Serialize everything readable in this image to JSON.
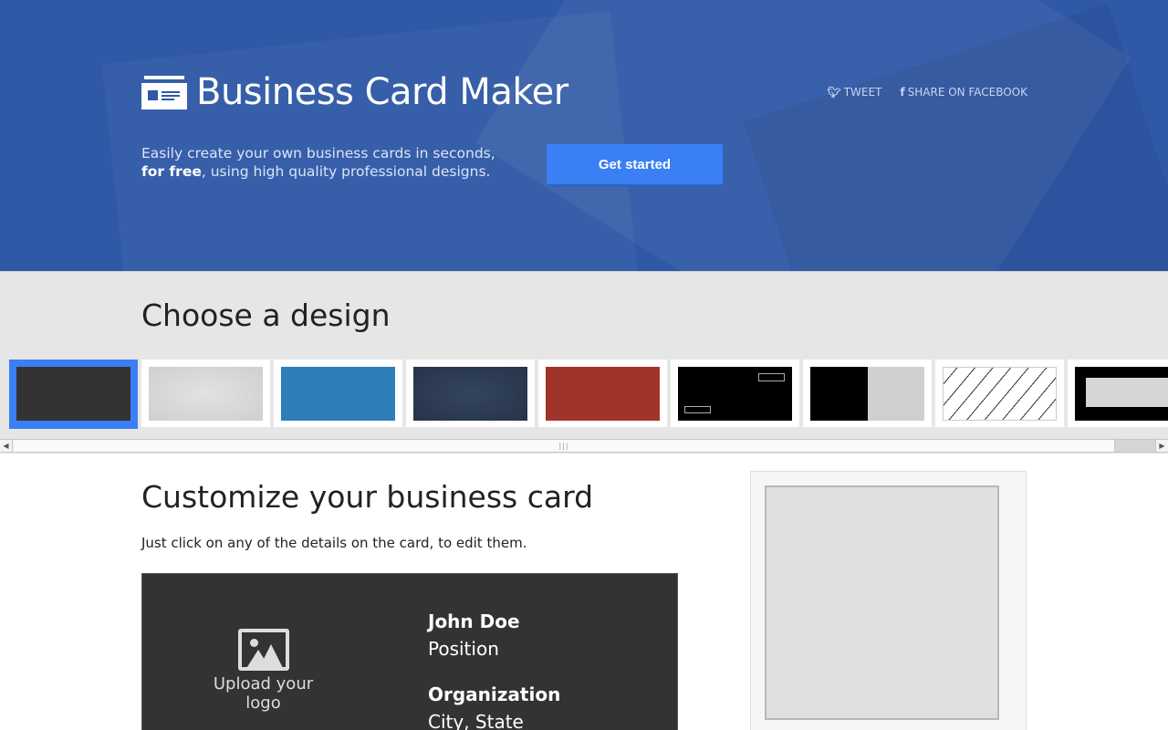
{
  "header": {
    "title": "Business Card Maker",
    "share": {
      "tweet_icon": "twitter-bird-icon",
      "tweet_label": "TWEET",
      "facebook_icon": "facebook-f-icon",
      "facebook_label": "SHARE ON FACEBOOK"
    },
    "tagline_line1": "Easily create your own business cards in seconds,",
    "tagline_bold": "for free",
    "tagline_rest": ", using high quality professional designs.",
    "cta_label": "Get started",
    "colors": {
      "background": "#2f58a6",
      "cta": "#3b7ff5"
    }
  },
  "designs": {
    "heading": "Choose a design",
    "selected_index": 0,
    "items": [
      {
        "style": "dark"
      },
      {
        "style": "light"
      },
      {
        "style": "blue"
      },
      {
        "style": "navy"
      },
      {
        "style": "red"
      },
      {
        "style": "black-outline"
      },
      {
        "style": "black-gray-split"
      },
      {
        "style": "diagonal-stripes"
      },
      {
        "style": "black-frame"
      }
    ]
  },
  "customize": {
    "heading": "Customize your business card",
    "hint": "Just click on any of the details on the card, to edit them.",
    "card": {
      "logo_icon": "image-icon",
      "logo_label": "Upload your logo",
      "name": "John Doe",
      "position": "Position",
      "organization": "Organization",
      "city_state": "City, State"
    }
  }
}
